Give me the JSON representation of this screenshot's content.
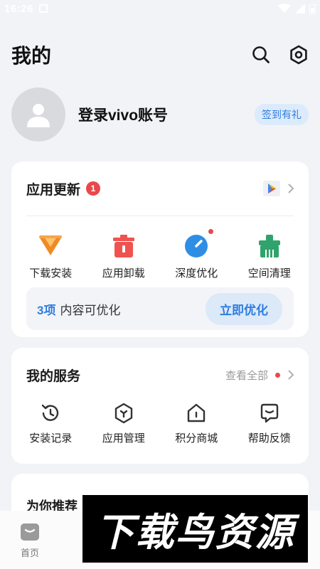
{
  "status_bar": {
    "time": "16:26"
  },
  "header": {
    "title": "我的",
    "icons": [
      "search-icon",
      "settings-icon"
    ]
  },
  "profile": {
    "login_label": "登录vivo账号",
    "signin_badge": "签到有礼"
  },
  "app_update": {
    "title": "应用更新",
    "badge_count": "1",
    "tools": [
      {
        "label": "下载安装",
        "icon": "download-icon",
        "color": "#f08a24"
      },
      {
        "label": "应用卸载",
        "icon": "trash-icon",
        "color": "#ef5350"
      },
      {
        "label": "深度优化",
        "icon": "gauge-icon",
        "color": "#2e8ee6"
      },
      {
        "label": "空间清理",
        "icon": "broom-icon",
        "color": "#2fa36b"
      }
    ],
    "optimize": {
      "count": "3项",
      "text": "内容可优化",
      "button": "立即优化"
    }
  },
  "services": {
    "title": "我的服务",
    "see_all": "查看全部",
    "items": [
      {
        "label": "安装记录",
        "icon": "history-icon"
      },
      {
        "label": "应用管理",
        "icon": "app-manage-icon"
      },
      {
        "label": "积分商城",
        "icon": "store-icon"
      },
      {
        "label": "帮助反馈",
        "icon": "feedback-icon"
      }
    ]
  },
  "recommend": {
    "title": "为你推荐"
  },
  "bottom_nav": {
    "home_label": "首页"
  },
  "watermark": {
    "text": "下载鸟资源"
  },
  "colors": {
    "accent": "#2f7de1",
    "badge_red": "#e9484b",
    "background": "#f2f3f7"
  }
}
